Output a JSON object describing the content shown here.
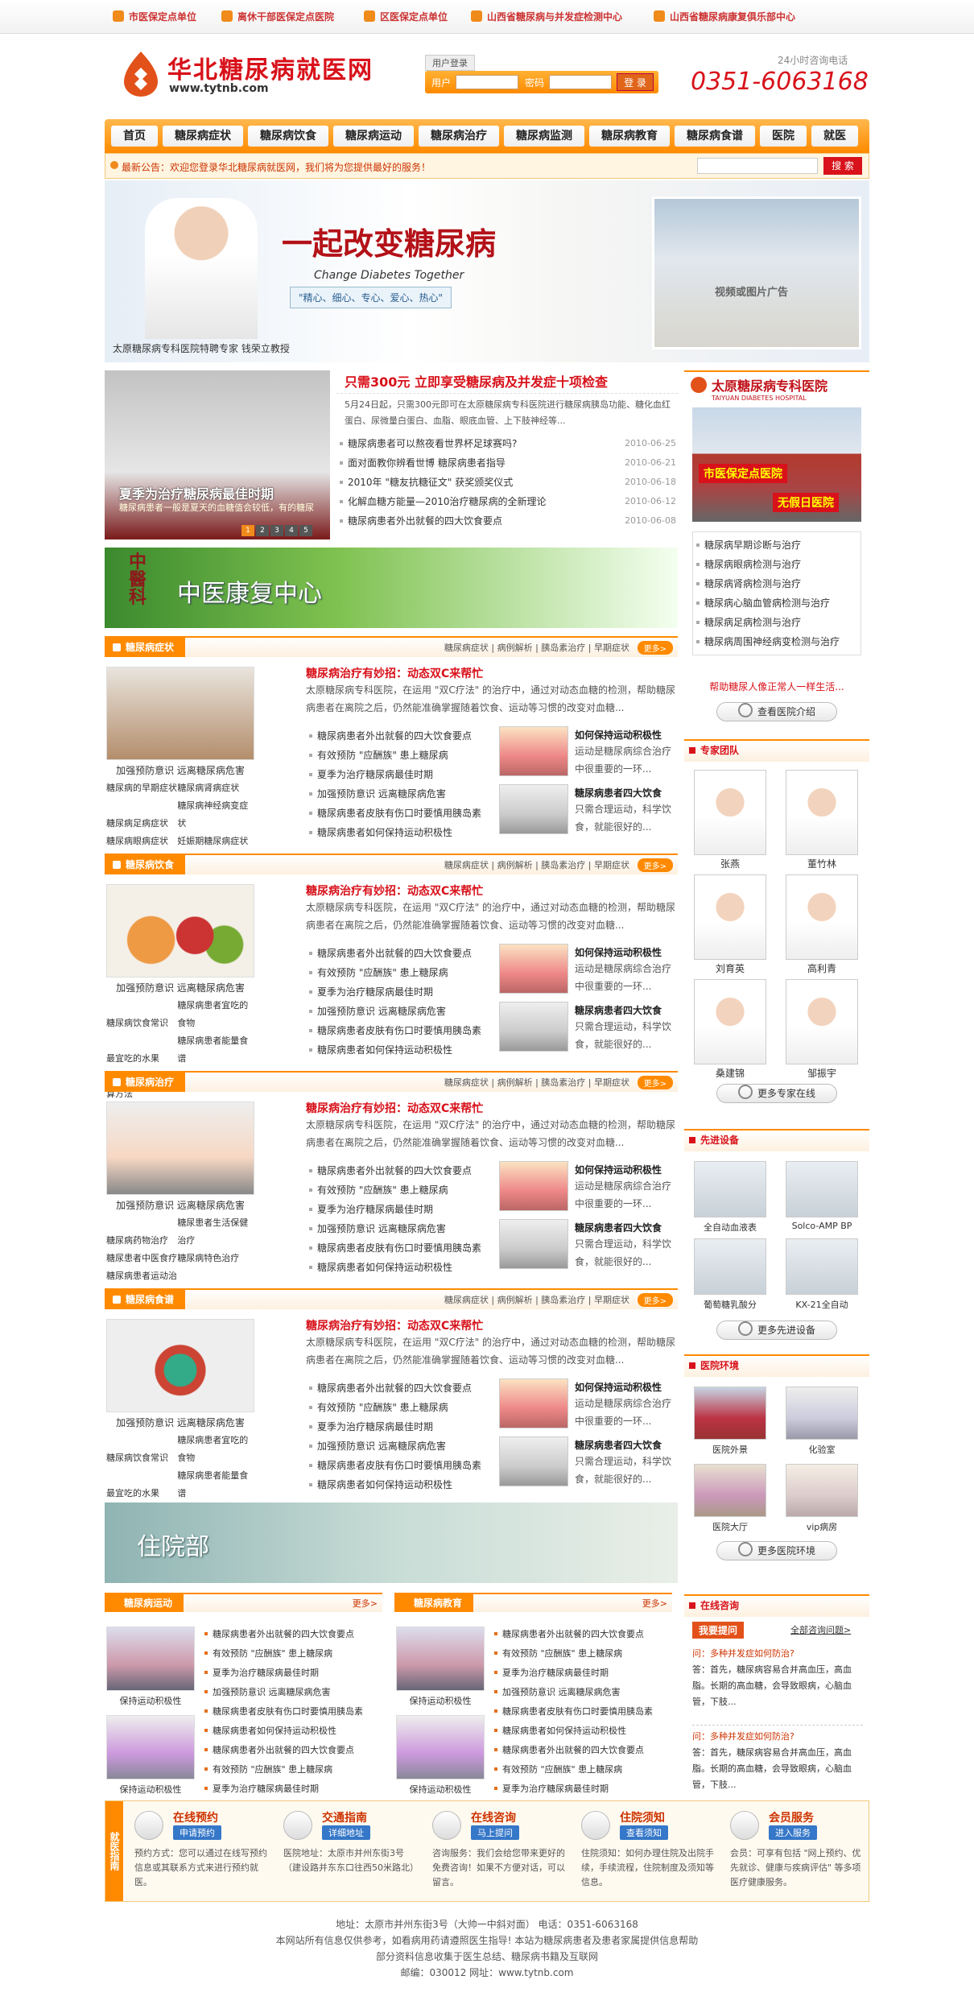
{
  "topbar": [
    "市医保定点单位",
    "离休干部医保定点医院",
    "区医保定点单位",
    "山西省糖尿病与并发症检测中心",
    "山西省糖尿病康复俱乐部中心"
  ],
  "logo": {
    "title": "华北糖尿病就医网",
    "url": "www.tytnb.com"
  },
  "login": {
    "header": "用户登录",
    "user_label": "用户",
    "pass_label": "密码",
    "button": "登 录"
  },
  "hotline": {
    "label": "24小时咨询电话",
    "number": "0351-6063168"
  },
  "nav": [
    "首页",
    "糖尿病症状",
    "糖尿病饮食",
    "糖尿病运动",
    "糖尿病治疗",
    "糖尿病监测",
    "糖尿病教育",
    "糖尿病食谱",
    "医院",
    "就医"
  ],
  "notice": {
    "text": "最新公告：欢迎您登录华北糖尿病就医网，我们将为您提供最好的服务！",
    "search_button": "搜 索"
  },
  "banner": {
    "slogan": "一起改变糖尿病",
    "english": "Change Diabetes Together",
    "tags": "\"精心、细心、专心、爱心、热心\"",
    "caption": "太原糖尿病专科医院特聘专家 钱荣立教授",
    "photo_text": "视频或图片广告"
  },
  "slide": {
    "caption": "夏季为治疗糖尿病最佳时期",
    "sub": "糖尿病患者一般是夏天的血糖值会较低，有的糖尿",
    "pages": [
      "1",
      "2",
      "3",
      "4",
      "5"
    ]
  },
  "headline": {
    "title": "只需300元 立即享受糖尿病及并发症十项检查",
    "desc": "5月24日起，只需300元即可在太原糖尿病专科医院进行糖尿病胰岛功能、糖化血红蛋白、尿微量白蛋白、血脂、眼底血管、上下肢神经等...",
    "news": [
      {
        "t": "糖尿病患者可以熬夜看世界杯足球赛吗?",
        "d": "2010-06-25"
      },
      {
        "t": "面对面教你辨看世博 糖尿病患者指导",
        "d": "2010-06-21"
      },
      {
        "t": "2010年 \"糖友抗糖征文\" 获奖颁奖仪式",
        "d": "2010-06-18"
      },
      {
        "t": "化解血糖方能量—2010治疗糖尿病的全新理论",
        "d": "2010-06-12"
      },
      {
        "t": "糖尿病患者外出就餐的四大饮食要点",
        "d": "2010-06-08"
      }
    ]
  },
  "tcm": {
    "side": "中醫科",
    "title": "中医康复中心"
  },
  "sections": [
    {
      "title": "糖尿病症状",
      "tabs": "糖尿病症状 | 病例解析 | 胰岛素治疗 | 早期症状",
      "more": "更多>",
      "imgcap": "加强预防意识 远离糖尿病危害",
      "links": [
        "糖尿病的早期症状",
        "糖尿病肾病症状",
        "糖尿病足病症状",
        "糖尿病神经病变症状",
        "糖尿病眼病症状",
        "妊娠期糖尿病症状"
      ]
    },
    {
      "title": "糖尿病饮食",
      "tabs": "糖尿病症状 | 病例解析 | 胰岛素治疗 | 早期症状",
      "more": "更多>",
      "imgcap": "加强预防意识 远离糖尿病危害",
      "links": [
        "糖尿病饮食常识",
        "糖尿病患者宜吃的食物",
        "最宜吃的水果",
        "糖尿病患者能量食谱",
        "糖尿病患者食谱计算方法"
      ]
    },
    {
      "title": "糖尿病治疗",
      "tabs": "糖尿病症状 | 病例解析 | 胰岛素治疗 | 早期症状",
      "more": "更多>",
      "imgcap": "加强预防意识 远离糖尿病危害",
      "links": [
        "糖尿病药物治疗",
        "糖尿患者生活保健治疗",
        "糖尿患者中医食疗",
        "糖尿病特色治疗",
        "糖尿病患者运动治疗"
      ]
    },
    {
      "title": "糖尿病食谱",
      "tabs": "糖尿病症状 | 病例解析 | 胰岛素治疗 | 早期症状",
      "more": "更多>",
      "imgcap": "加强预防意识 远离糖尿病危害",
      "links": [
        "糖尿病饮食常识",
        "糖尿病患者宜吃的食物",
        "最宜吃的水果",
        "糖尿病患者能量食谱",
        "糖尿病患者食谱计算方法"
      ]
    }
  ],
  "article": {
    "title": "糖尿病治疗有妙招：动态双C来帮忙",
    "desc": "太原糖尿病专科医院，在运用 \"双C疗法\" 的治疗中，通过对动态血糖的检测，帮助糖尿病患者在离院之后，仍然能准确掌握随着饮食、运动等习惯的改变对血糖...",
    "list": [
      "糖尿病患者外出就餐的四大饮食要点",
      "有效预防 \"应酬族\" 患上糖尿病",
      "夏季为治疗糖尿病最佳时期",
      "加强预防意识 远离糖尿病危害",
      "糖尿病患者皮肤有伤口时要慎用胰岛素",
      "糖尿病患者如何保持运动积极性"
    ],
    "mini1": {
      "t": "如何保持运动积极性",
      "d": "运动是糖尿病综合治疗中很重要的一环..."
    },
    "mini2": {
      "t": "糖尿病患者四大饮食",
      "d": "只需合理运动，科学饮食，就能很好的..."
    }
  },
  "inpatient": "住院部",
  "right": {
    "hospital": "太原糖尿病专科医院",
    "hospital_en": "TAIYUAN DIABETES HOSPITAL",
    "badge1": "市医保定点医院",
    "badge2": "无假日医院",
    "list": [
      "糖尿病早期诊断与治疗",
      "糖尿病眼病检测与治疗",
      "糖尿病肾病检测与治疗",
      "糖尿病心脑血管病检测与治疗",
      "糖尿病足病检测与治疗",
      "糖尿病周围神经病变检测与治疗"
    ],
    "help": "帮助糖尿人像正常人一样生活...",
    "intro_btn": "查看医院介绍",
    "experts_title": "专家团队",
    "experts": [
      "张燕",
      "董竹林",
      "刘育英",
      "高利青",
      "桑建锦",
      "邹振宇"
    ],
    "experts_btn": "更多专家在线",
    "equip_title": "先进设备",
    "equip": [
      "全自动血液表",
      "Solco-AMP BP",
      "葡萄糖乳酸分",
      "KX-21全自动"
    ],
    "equip_btn": "更多先进设备",
    "env_title": "医院环境",
    "env": [
      "医院外景",
      "化验室",
      "医院大厅",
      "vip病房"
    ],
    "env_btn": "更多医院环境",
    "consult_title": "在线咨询",
    "ask_btn": "我要提问",
    "all_q": "全部咨询问题>",
    "qa": [
      {
        "q": "问：多种并发症如何防治?",
        "a": "答：首先，糖尿病容易合并高血压，高血脂。长期的高血糖，会导致眼病，心脑血管，下肢..."
      },
      {
        "q": "问：多种并发症如何防治?",
        "a": "答：首先，糖尿病容易合并高血压，高血脂。长期的高血糖，会导致眼病，心脑血管，下肢..."
      }
    ]
  },
  "bottom": [
    {
      "title": "糖尿病运动",
      "more": "更多>",
      "caps": [
        "保持运动积极性",
        "保持运动积极性"
      ],
      "list": [
        "糖尿病患者外出就餐的四大饮食要点",
        "有效预防 \"应酬族\" 患上糖尿病",
        "夏季为治疗糖尿病最佳时期",
        "加强预防意识 远离糖尿病危害",
        "糖尿病患者皮肤有伤口时要慎用胰岛素",
        "糖尿病患者如何保持运动积极性",
        "糖尿病患者外出就餐的四大饮食要点",
        "有效预防 \"应酬族\" 患上糖尿病",
        "夏季为治疗糖尿病最佳时期"
      ]
    },
    {
      "title": "糖尿病教育",
      "more": "更多>",
      "caps": [
        "保持运动积极性",
        "保持运动积极性"
      ],
      "list": [
        "糖尿病患者外出就餐的四大饮食要点",
        "有效预防 \"应酬族\" 患上糖尿病",
        "夏季为治疗糖尿病最佳时期",
        "加强预防意识 远离糖尿病危害",
        "糖尿病患者皮肤有伤口时要慎用胰岛素",
        "糖尿病患者如何保持运动积极性",
        "糖尿病患者外出就餐的四大饮食要点",
        "有效预防 \"应酬族\" 患上糖尿病",
        "夏季为治疗糖尿病最佳时期"
      ]
    }
  ],
  "service": {
    "side": "就医指南",
    "blocks": [
      {
        "t": "在线预约",
        "b": "申请预约",
        "d": "预约方式：您可以通过在线写预约信息或其联系方式来进行预约就医。"
      },
      {
        "t": "交通指南",
        "b": "详细地址",
        "d": "医院地址：太原市并州东街3号（建设路并东东口往西50米路北）"
      },
      {
        "t": "在线咨询",
        "b": "马上提问",
        "d": "咨询服务：我们会给您带来更好的免费咨询！如果不方便对话，可以留言。"
      },
      {
        "t": "住院须知",
        "b": "查看须知",
        "d": "住院须知：如何办理住院及出院手续，手续流程，住院制度及须知等信息。"
      },
      {
        "t": "会员服务",
        "b": "进入服务",
        "d": "会员：可享有包括 \"网上预约、优先就诊、健康与疾病评估\" 等多项医疗健康服务。"
      }
    ]
  },
  "footer": [
    "地址：太原市并州东街3号（大帅一中斜对面）    电话：0351-6063168",
    "本网站所有信息仅供参考，如看病用药请遵照医生指导! 本站为糖尿病患者及患者家属提供信息帮助",
    "部分资料信息收集于医生总结、糖尿病书籍及互联网",
    "邮编：030012    网址：www.tytnb.com"
  ]
}
